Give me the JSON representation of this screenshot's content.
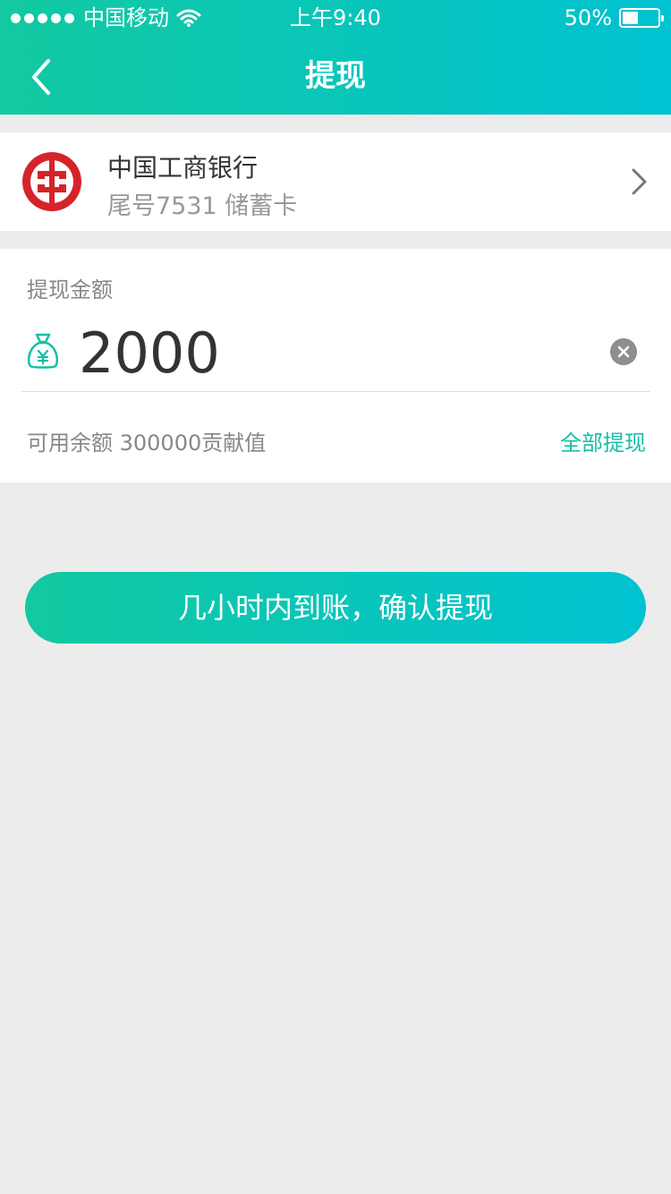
{
  "status_bar": {
    "carrier": "中国移动",
    "time": "上午9:40",
    "battery_percent": "50%",
    "battery_level": 0.5
  },
  "nav": {
    "title": "提现",
    "back_icon": "chevron-left-icon"
  },
  "bank_card": {
    "logo_icon": "icbc-logo-icon",
    "name": "中国工商银行",
    "subtitle": "尾号7531 储蓄卡",
    "chevron_icon": "chevron-right-icon"
  },
  "withdraw": {
    "label": "提现金额",
    "currency_icon": "moneybag-icon",
    "amount": "2000",
    "clear_icon": "clear-icon",
    "balance_text": "可用余额 300000贡献值",
    "withdraw_all_label": "全部提现"
  },
  "confirm": {
    "label": "几小时内到账，确认提现"
  },
  "colors": {
    "accent_start": "#12c9a0",
    "accent_end": "#00c2d1",
    "icbc_red": "#d6232a",
    "link_green": "#14bfa6",
    "background": "#ececec"
  }
}
